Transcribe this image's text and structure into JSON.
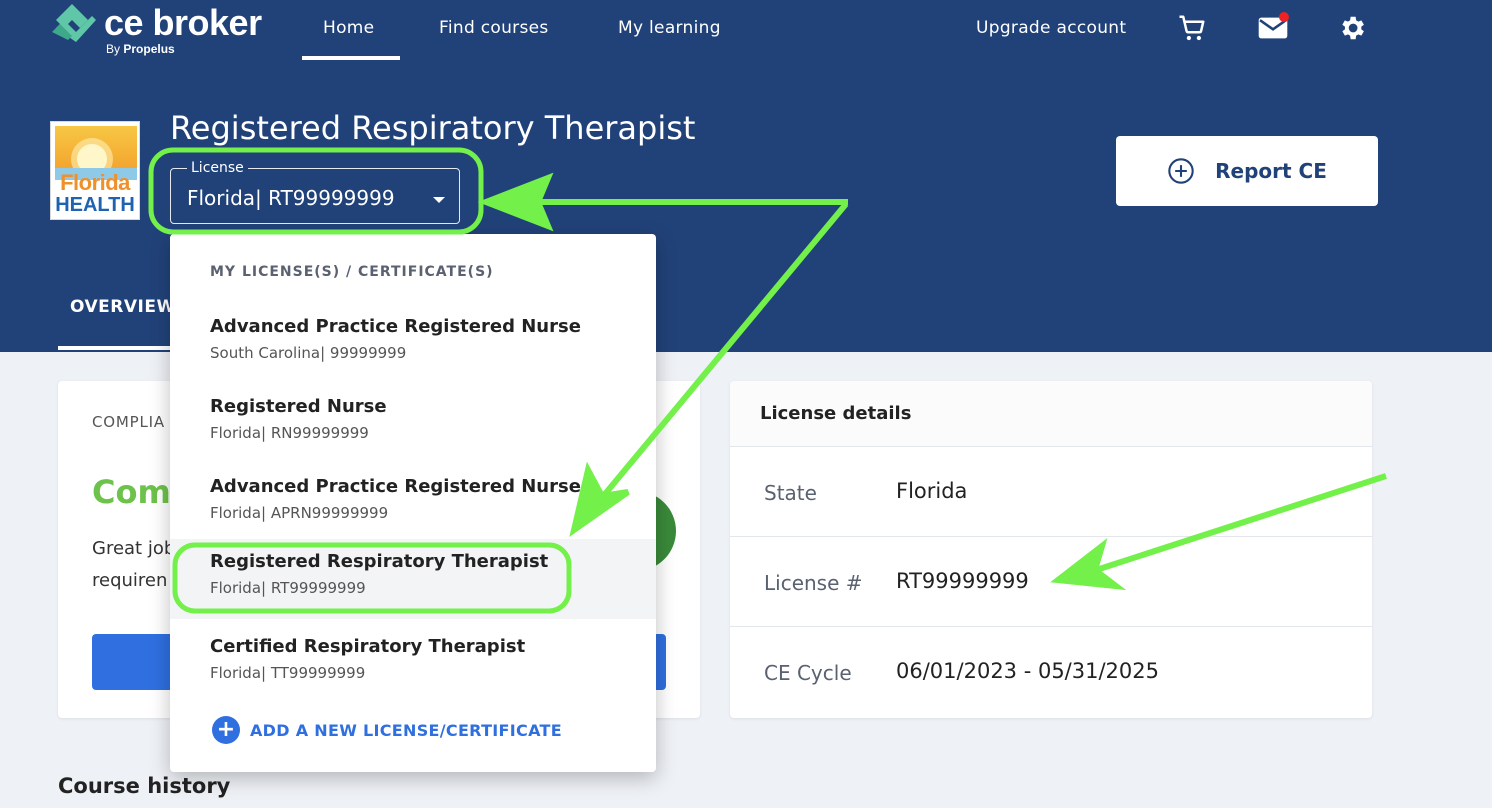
{
  "brand": {
    "name": "ce broker",
    "by": "By",
    "company": "Propelus"
  },
  "nav": {
    "home": "Home",
    "find_courses": "Find courses",
    "my_learning": "My learning",
    "upgrade": "Upgrade account"
  },
  "icons": {
    "cart": "cart-icon",
    "mail": "mail-icon",
    "settings": "gear-icon"
  },
  "license_header": {
    "logo_line1": "Florida",
    "logo_line2": "HEALTH",
    "title": "Registered Respiratory Therapist",
    "select_label": "License",
    "select_value": "Florida| RT99999999",
    "report_button": "Report CE"
  },
  "tabs": {
    "overview": "OVERVIEW"
  },
  "dropdown": {
    "header": "MY LICENSE(S) / CERTIFICATE(S)",
    "items": [
      {
        "title": "Advanced Practice Registered Nurse",
        "sub": "South Carolina| 99999999"
      },
      {
        "title": "Registered Nurse",
        "sub": "Florida| RN99999999"
      },
      {
        "title": "Advanced Practice Registered Nurse",
        "sub": "Florida| APRN99999999"
      },
      {
        "title": "Registered Respiratory Therapist",
        "sub": "Florida| RT99999999"
      },
      {
        "title": "Certified Respiratory Therapist",
        "sub": "Florida| TT99999999"
      }
    ],
    "selected_index": 3,
    "add_label": "ADD A NEW LICENSE/CERTIFICATE"
  },
  "compliance": {
    "label": "COMPLIA",
    "status": "Comp",
    "text_line1": "Great job",
    "text_line2": "requiren"
  },
  "license_details": {
    "title": "License details",
    "rows": [
      {
        "key": "State",
        "value": "Florida"
      },
      {
        "key": "License #",
        "value": "RT99999999"
      },
      {
        "key": "CE Cycle",
        "value": "06/01/2023 - 05/31/2025"
      }
    ]
  },
  "course_history": "Course history",
  "colors": {
    "header_bg": "#214279",
    "accent_blue": "#2f6fe0",
    "success_green": "#6cc24a",
    "annotation_green": "#73f04a",
    "notification_red": "#ee2222"
  }
}
